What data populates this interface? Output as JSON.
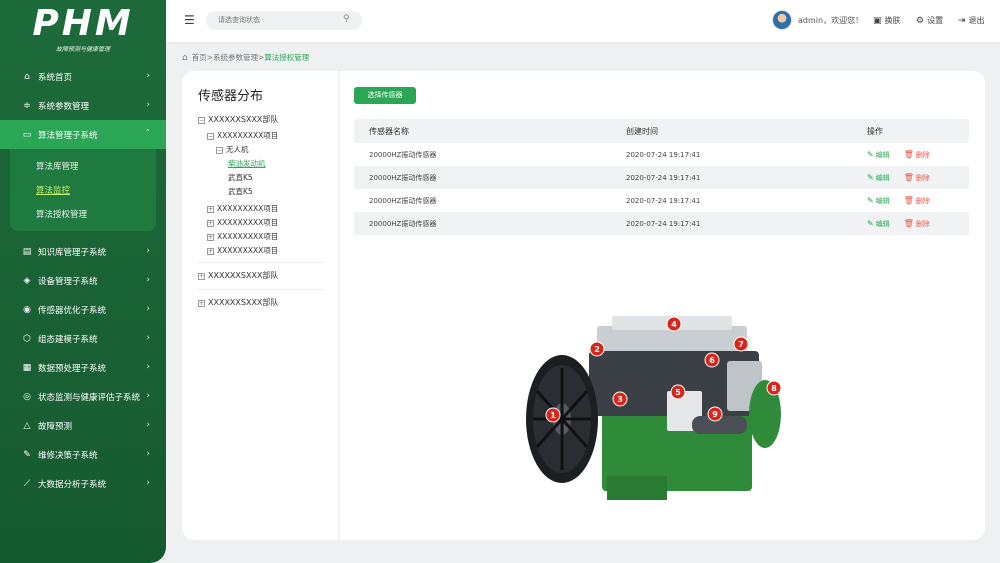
{
  "logo": {
    "title": "PHM",
    "subtitle": "故障预测与健康管理"
  },
  "nav": [
    {
      "label": "系统首页",
      "icon": "home-icon"
    },
    {
      "label": "系统参数管理",
      "icon": "sliders-icon"
    },
    {
      "label": "算法管理子系统",
      "icon": "monitor-icon",
      "active": true,
      "children": [
        "算法库管理",
        "算法监控",
        "算法授权管理"
      ],
      "selected_child": "算法监控"
    },
    {
      "label": "知识库管理子系统",
      "icon": "document-icon"
    },
    {
      "label": "设备管理子系统",
      "icon": "layers-icon"
    },
    {
      "label": "传感器优化子系统",
      "icon": "signal-icon"
    },
    {
      "label": "组态建模子系统",
      "icon": "shield-icon"
    },
    {
      "label": "数据预处理子系统",
      "icon": "database-icon"
    },
    {
      "label": "状态监测与健康评估子系统",
      "icon": "gauge-icon"
    },
    {
      "label": "故障预测",
      "icon": "warning-icon"
    },
    {
      "label": "维修决策子系统",
      "icon": "wrench-icon"
    },
    {
      "label": "大数据分析子系统",
      "icon": "chart-icon"
    }
  ],
  "topbar": {
    "search_placeholder": "请选查询状态",
    "user": "admin，欢迎您！",
    "skin": "换肤",
    "settings": "设置",
    "logout": "退出"
  },
  "breadcrumb": {
    "home": "首页",
    "sep": ">",
    "level1": "系统参数管理",
    "current": "算法授权管理"
  },
  "panel": {
    "title": "传感器分布",
    "tree": {
      "unit1": "XXXXXXSXXX部队",
      "project1": "XXXXXXXXX项目",
      "drone": "无人机",
      "leaf_selected": "柴油发动机",
      "leaf2": "武直K5",
      "leaf3": "武直K5",
      "projects": [
        "XXXXXXXXX项目",
        "XXXXXXXXX项目",
        "XXXXXXXXX项目",
        "XXXXXXXXX项目"
      ],
      "unit2": "XXXXXXSXXX部队",
      "unit3": "XXXXXXSXXX部队"
    }
  },
  "toolbar": {
    "add_label": "选择传感器"
  },
  "table": {
    "headers": [
      "传感器名称",
      "创建时间",
      "操作"
    ],
    "edit_label": "编辑",
    "delete_label": "删除",
    "rows": [
      {
        "name": "20000HZ振动传感器",
        "time": "2020-07-24 19:17:41"
      },
      {
        "name": "20000HZ振动传感器",
        "time": "2020-07-24 19:17:41"
      },
      {
        "name": "20000HZ振动传感器",
        "time": "2020-07-24 19:17:41"
      },
      {
        "name": "20000HZ振动传感器",
        "time": "2020-07-24 19:17:41"
      }
    ]
  },
  "sensor_markers": [
    "1",
    "2",
    "3",
    "4",
    "5",
    "6",
    "7",
    "8",
    "9"
  ],
  "colors": {
    "primary": "#2aa655",
    "sidebar": "#1d6b3a",
    "danger": "#e85b4b",
    "marker": "#d9261c"
  }
}
